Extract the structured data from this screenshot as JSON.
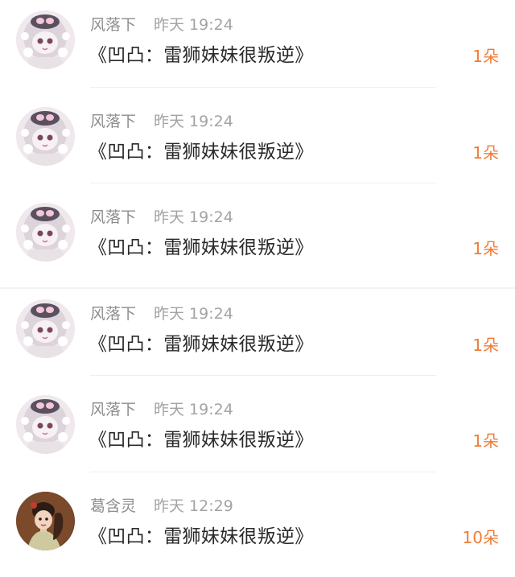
{
  "items": [
    {
      "name": "风落下",
      "time": "昨天 19:24",
      "title": "《凹凸：雷狮妹妹很叛逆》",
      "count": "1朵",
      "avatar": "anime-girl-avatar-icon"
    },
    {
      "name": "风落下",
      "time": "昨天 19:24",
      "title": "《凹凸：雷狮妹妹很叛逆》",
      "count": "1朵",
      "avatar": "anime-girl-avatar-icon"
    },
    {
      "name": "风落下",
      "time": "昨天 19:24",
      "title": "《凹凸：雷狮妹妹很叛逆》",
      "count": "1朵",
      "avatar": "anime-girl-avatar-icon"
    },
    {
      "name": "风落下",
      "time": "昨天 19:24",
      "title": "《凹凸：雷狮妹妹很叛逆》",
      "count": "1朵",
      "avatar": "anime-girl-avatar-icon"
    },
    {
      "name": "风落下",
      "time": "昨天 19:24",
      "title": "《凹凸：雷狮妹妹很叛逆》",
      "count": "1朵",
      "avatar": "anime-girl-avatar-icon"
    },
    {
      "name": "葛含灵",
      "time": "昨天 12:29",
      "title": "《凹凸：雷狮妹妹很叛逆》",
      "count": "10朵",
      "avatar": "illustrated-girl-avatar-icon"
    }
  ],
  "colors": {
    "name": "#8d8d8d",
    "time": "#a3a3a3",
    "title": "#2a2a2a",
    "count_accent": "#f07c37"
  }
}
